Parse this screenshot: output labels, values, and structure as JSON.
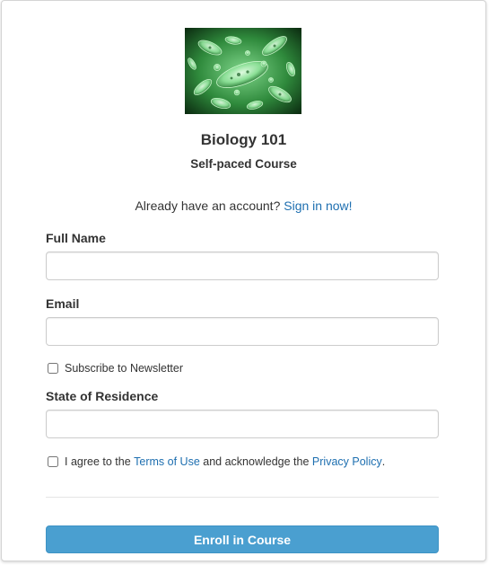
{
  "course": {
    "image_alt": "green bacteria cells",
    "title": "Biology 101",
    "subtitle": "Self-paced Course"
  },
  "signin": {
    "prompt": "Already have an account?",
    "link_label": "Sign in now!"
  },
  "form": {
    "full_name": {
      "label": "Full Name",
      "value": "",
      "placeholder": ""
    },
    "email": {
      "label": "Email",
      "value": "",
      "placeholder": ""
    },
    "newsletter": {
      "label": "Subscribe to Newsletter",
      "checked": false
    },
    "state": {
      "label": "State of Residence",
      "value": "",
      "placeholder": ""
    },
    "terms": {
      "prefix": "I agree to the",
      "terms_link": "Terms of Use",
      "middle": "and acknowledge the",
      "privacy_link": "Privacy Policy",
      "suffix": ".",
      "checked": false
    },
    "submit_label": "Enroll in Course"
  },
  "colors": {
    "link": "#1e6fb0",
    "button": "#4a9fd0",
    "border": "#cccccc"
  }
}
